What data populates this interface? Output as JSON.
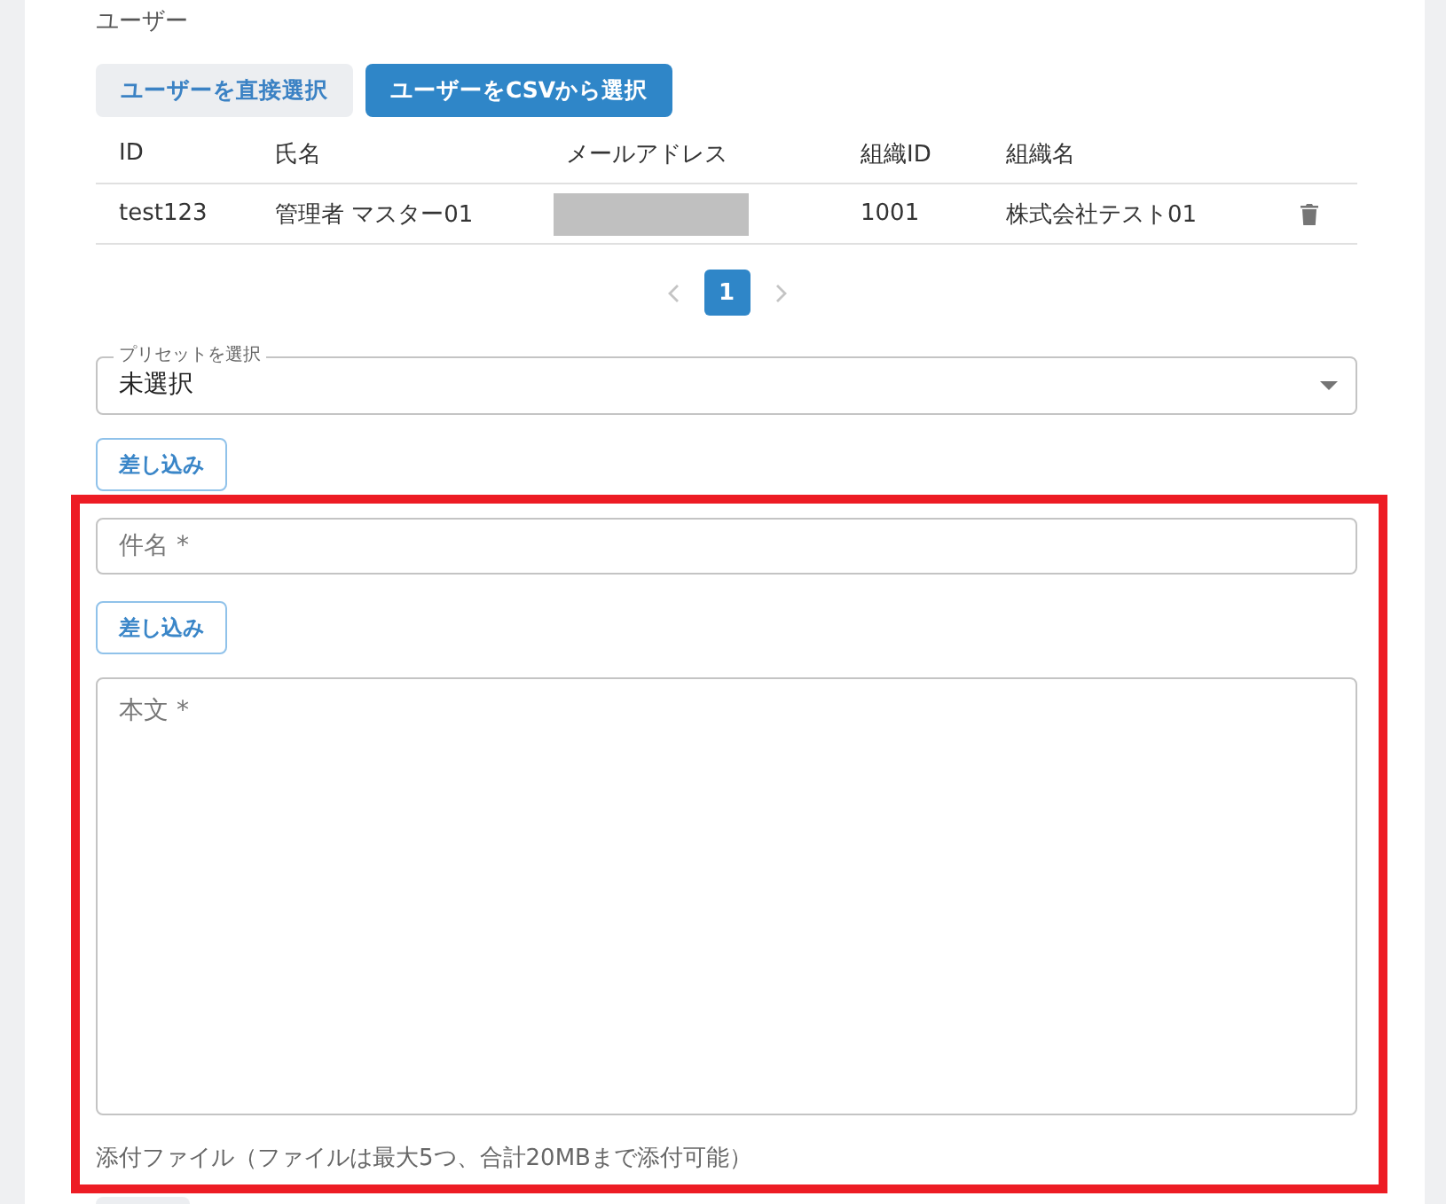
{
  "section_label": "ユーザー",
  "user_buttons": [
    {
      "label": "ユーザーを直接選択",
      "kind": "secondary"
    },
    {
      "label": "ユーザーをCSVから選択",
      "kind": "primary"
    }
  ],
  "table": {
    "columns": [
      "ID",
      "氏名",
      "メールアドレス",
      "組織ID",
      "組織名"
    ],
    "rows": [
      {
        "id": "test123",
        "name": "管理者 マスター01",
        "email_redacted": true,
        "org_id": "1001",
        "org_name": "株式会社テスト01"
      }
    ]
  },
  "pagination": {
    "prev": {
      "disabled": true
    },
    "pages": [
      {
        "label": "1",
        "selected": true
      }
    ],
    "next": {
      "disabled": true
    }
  },
  "preset": {
    "label": "プリセットを選択",
    "value": "未選択",
    "insert_button": "差し込み"
  },
  "compose": {
    "highlighted": true,
    "subject": {
      "placeholder": "件名 *"
    },
    "insert_button": "差し込み",
    "body": {
      "placeholder": "本文 *"
    },
    "attachment_note": "添付ファイル（ファイルは最大5つ、合計20MBまで添付可能）"
  }
}
